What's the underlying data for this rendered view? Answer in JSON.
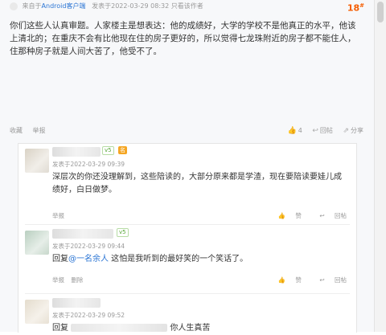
{
  "post": {
    "source_prefix": "来自于",
    "source_link": "Android客户端",
    "published": "发表于2022-03-29 08:32",
    "only_author": "只看该作者",
    "floor": "18",
    "floor_sup": "#",
    "body": "你们这些人认真审题。人家楼主是想表达：他的成绩好，大学的学校不是他真正的水平，他该上清北的；在重庆不会有比他现在住的房子更好的，所以觉得七龙珠附近的房子都不能住人，住那种房子就是人间大苦了，他受不了。",
    "actions": {
      "favorite": "收藏",
      "report": "举报",
      "like_count": "4",
      "reply": "回帖",
      "share": "分享"
    }
  },
  "comments": [
    {
      "level": "v5",
      "badge": "名",
      "time": "发表于2022-03-29 09:39",
      "text": "深层次的你还没理解到，这些陪读的，大部分原来都是学渣，现在要陪读要娃儿成绩好，白日做梦。",
      "report": "举报",
      "like": "赞",
      "reply": "回帖"
    },
    {
      "level": "v5",
      "time": "发表于2022-03-29 09:44",
      "text_prefix": "回复",
      "mention": "@一名余人",
      "text_suffix": " 这怕是我听到的最好笑的一个笑话了。",
      "report": "举报",
      "delete": "删除",
      "like": "赞",
      "reply": "回帖"
    },
    {
      "time": "发表于2022-03-29 09:52",
      "text_prefix": "回复",
      "text_suffix": "你人生真苦"
    }
  ]
}
